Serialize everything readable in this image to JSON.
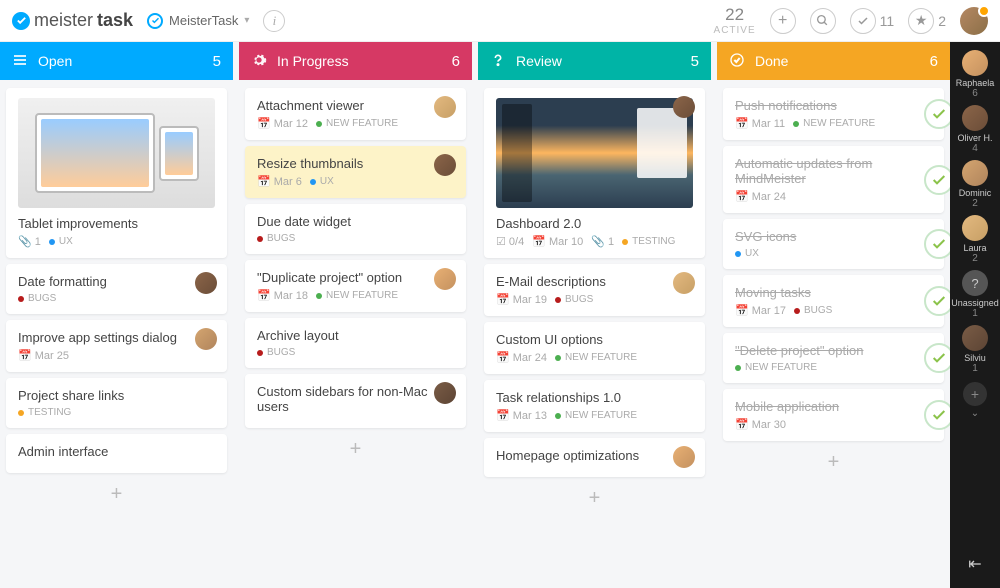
{
  "app": {
    "brand1": "meister",
    "brand2": "task"
  },
  "project": {
    "name": "MeisterTask"
  },
  "stats": {
    "active_count": "22",
    "active_label": "ACTIVE",
    "done_count": "11",
    "star_count": "2"
  },
  "columns": [
    {
      "name": "Open",
      "count": "5",
      "cls": "c-open",
      "icon": "menu"
    },
    {
      "name": "In Progress",
      "count": "6",
      "cls": "c-progress",
      "icon": "gear"
    },
    {
      "name": "Review",
      "count": "5",
      "cls": "c-review",
      "icon": "question"
    },
    {
      "name": "Done",
      "count": "6",
      "cls": "c-done",
      "icon": "check"
    }
  ],
  "cards": {
    "open": [
      {
        "title": "Tablet improvements",
        "thumb": "tablet",
        "clip": "1",
        "tag": "UX",
        "tagColor": "#2196f3"
      },
      {
        "title": "Date formatting",
        "tag": "BUGS",
        "tagColor": "#b71c1c",
        "assignee": "av-2"
      },
      {
        "title": "Improve app settings dialog",
        "date": "Mar 25",
        "assignee": "av-3"
      },
      {
        "title": "Project share links",
        "tag": "TESTING",
        "tagColor": "#f5a623"
      },
      {
        "title": "Admin interface"
      }
    ],
    "progress": [
      {
        "title": "Attachment viewer",
        "date": "Mar 12",
        "tag": "NEW FEATURE",
        "tagColor": "#4caf50",
        "assignee": "av-4"
      },
      {
        "title": "Resize thumbnails",
        "date": "Mar 6",
        "tag": "UX",
        "tagColor": "#2196f3",
        "assignee": "av-2",
        "highlight": true
      },
      {
        "title": "Due date widget",
        "tag": "BUGS",
        "tagColor": "#b71c1c"
      },
      {
        "title": "\"Duplicate project\" option",
        "date": "Mar 18",
        "tag": "NEW FEATURE",
        "tagColor": "#4caf50",
        "assignee": "av-1"
      },
      {
        "title": "Archive layout",
        "tag": "BUGS",
        "tagColor": "#b71c1c"
      },
      {
        "title": "Custom sidebars for non-Mac users",
        "assignee": "av-5"
      }
    ],
    "review": [
      {
        "title": "Dashboard 2.0",
        "thumb": "sunset",
        "checklist": "0/4",
        "date": "Mar 10",
        "clip": "1",
        "tag": "TESTING",
        "tagColor": "#f5a623",
        "assignee": "av-2"
      },
      {
        "title": "E-Mail descriptions",
        "date": "Mar 19",
        "tag": "BUGS",
        "tagColor": "#b71c1c",
        "assignee": "av-4"
      },
      {
        "title": "Custom UI options",
        "date": "Mar 24",
        "tag": "NEW FEATURE",
        "tagColor": "#4caf50"
      },
      {
        "title": "Task relationships 1.0",
        "date": "Mar 13",
        "tag": "NEW FEATURE",
        "tagColor": "#4caf50"
      },
      {
        "title": "Homepage optimizations",
        "assignee": "av-1"
      }
    ],
    "done": [
      {
        "title": "Push notifications",
        "date": "Mar 11",
        "tag": "NEW FEATURE",
        "tagColor": "#4caf50",
        "done": true
      },
      {
        "title": "Automatic updates from MindMeister",
        "date": "Mar 24",
        "done": true
      },
      {
        "title": "SVG icons",
        "tag": "UX",
        "tagColor": "#2196f3",
        "done": true
      },
      {
        "title": "Moving tasks",
        "date": "Mar 17",
        "tag": "BUGS",
        "tagColor": "#b71c1c",
        "done": true
      },
      {
        "title": "\"Delete project\" option",
        "tag": "NEW FEATURE",
        "tagColor": "#4caf50",
        "done": true
      },
      {
        "title": "Mobile application",
        "date": "Mar 30",
        "done": true
      }
    ]
  },
  "team": [
    {
      "name": "Raphaela",
      "count": "6",
      "av": "av-1"
    },
    {
      "name": "Oliver H.",
      "count": "4",
      "av": "av-2"
    },
    {
      "name": "Dominic",
      "count": "2",
      "av": "av-3"
    },
    {
      "name": "Laura",
      "count": "2",
      "av": "av-4"
    },
    {
      "name": "Unassigned",
      "count": "1",
      "av": "av-q",
      "q": true
    },
    {
      "name": "Silviu",
      "count": "1",
      "av": "av-5"
    }
  ]
}
